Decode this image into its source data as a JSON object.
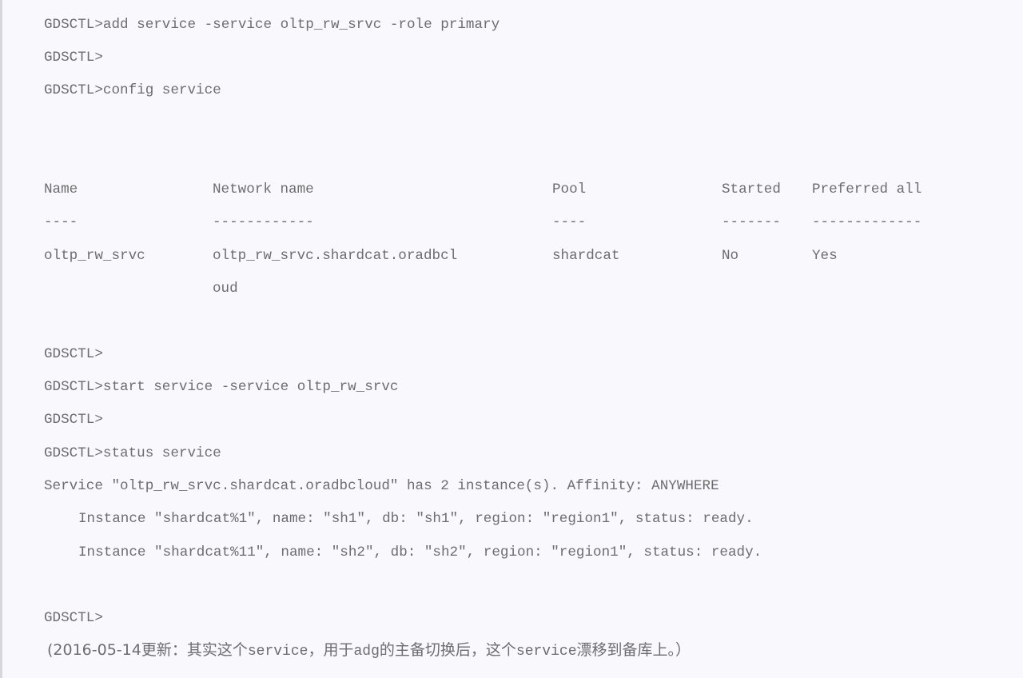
{
  "terminal": {
    "prompt": "GDSCTL>",
    "lines_top": [
      "GDSCTL>add service -service oltp_rw_srvc -role primary",
      "GDSCTL>",
      "GDSCTL>config service"
    ],
    "config_table": {
      "headers": [
        "Name",
        "Network name",
        "Pool",
        "Started",
        "Preferred all"
      ],
      "separators": [
        "----",
        "------------",
        "----",
        "-------",
        "-------------"
      ],
      "rows": [
        {
          "name": "oltp_rw_srvc",
          "network_name_line1": "oltp_rw_srvc.shardcat.oradbcl",
          "network_name_line2": "oud",
          "pool": "shardcat",
          "started": "No",
          "preferred_all": "Yes"
        }
      ]
    },
    "lines_middle": [
      "GDSCTL>",
      "GDSCTL>start service -service oltp_rw_srvc",
      "GDSCTL>",
      "GDSCTL>status service"
    ],
    "status_output": {
      "summary": "Service \"oltp_rw_srvc.shardcat.oradbcloud\" has 2 instance(s). Affinity: ANYWHERE",
      "instances": [
        "Instance \"shardcat%1\", name: \"sh1\", db: \"sh1\", region: \"region1\", status: ready.",
        "Instance \"shardcat%11\", name: \"sh2\", db: \"sh2\", region: \"region1\", status: ready."
      ]
    },
    "line_final_prompt": "GDSCTL>"
  },
  "note": {
    "open": "(2016-05-14更新：其实这个",
    "word1": "service",
    "mid1": "，用于",
    "word2": "adg",
    "mid2": "的主备切换后，这个",
    "word3": "service",
    "close": "漂移到备库上。）"
  },
  "colors": {
    "background": "#f9f9fd",
    "text": "#6d6d70",
    "border": "#d7d7db"
  }
}
